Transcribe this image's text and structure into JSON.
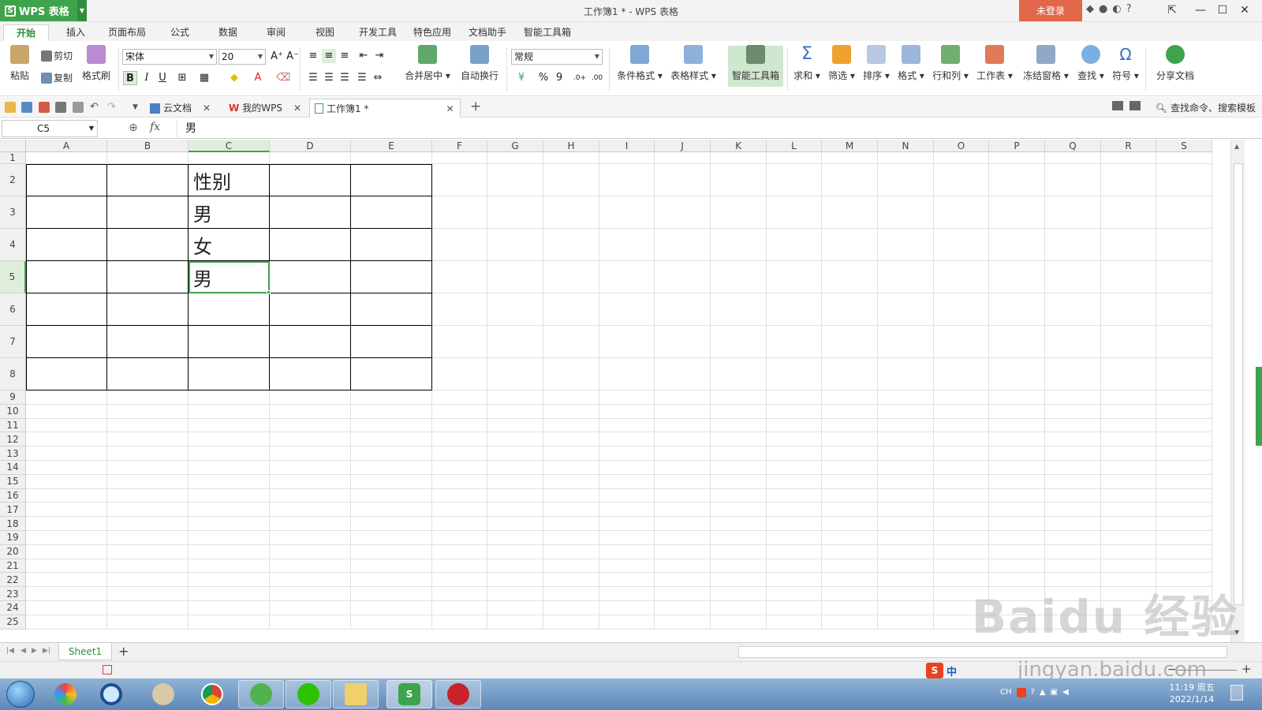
{
  "titlebar": {
    "app_name": "WPS 表格",
    "window_title": "工作簿1 * - WPS 表格",
    "login_label": "未登录",
    "help_label": "?"
  },
  "menu": {
    "tabs": [
      {
        "label": "开始"
      },
      {
        "label": "插入"
      },
      {
        "label": "页面布局"
      },
      {
        "label": "公式"
      },
      {
        "label": "数据"
      },
      {
        "label": "审阅"
      },
      {
        "label": "视图"
      },
      {
        "label": "开发工具"
      },
      {
        "label": "特色应用"
      },
      {
        "label": "文档助手"
      },
      {
        "label": "智能工具箱"
      }
    ]
  },
  "ribbon": {
    "paste": "粘贴",
    "cut": "剪切",
    "copy": "复制",
    "format_painter": "格式刷",
    "font_name": "宋体",
    "font_size": "20",
    "bold": "B",
    "italic": "I",
    "underline": "U",
    "merge_center": "合并居中",
    "wrap_text": "自动换行",
    "number_format": "常规",
    "percent": "%",
    "comma": "9",
    "conditional_format": "条件格式",
    "table_style": "表格样式",
    "smart_toolbox": "智能工具箱",
    "sum": "求和",
    "filter": "筛选",
    "sort": "排序",
    "format": "格式",
    "row_col": "行和列",
    "worksheet": "工作表",
    "freeze": "冻结窗格",
    "find": "查找",
    "symbol": "符号",
    "share": "分享文档"
  },
  "doc_tabs": [
    {
      "label": "云文档"
    },
    {
      "label": "我的WPS"
    },
    {
      "label": "工作簿1 *"
    }
  ],
  "search_command": "查找命令、搜索模板",
  "formula": {
    "name_box": "C5",
    "fx": "fx",
    "value": "男"
  },
  "sheet": {
    "columns": [
      "A",
      "B",
      "C",
      "D",
      "E",
      "F",
      "G",
      "H",
      "I",
      "J",
      "K",
      "L",
      "M",
      "N",
      "O",
      "P",
      "Q",
      "R",
      "S"
    ],
    "rows": [
      "1",
      "2",
      "3",
      "4",
      "5",
      "6",
      "7",
      "8",
      "9",
      "10",
      "11",
      "12",
      "13",
      "14",
      "15",
      "16",
      "17",
      "18",
      "19",
      "20",
      "21",
      "22",
      "23",
      "24",
      "25"
    ],
    "cells": {
      "C2": "性别",
      "C3": "男",
      "C4": "女",
      "C5": "男"
    },
    "selected_cell": "C5",
    "tabs": [
      {
        "label": "Sheet1"
      }
    ]
  },
  "statusbar": {
    "ime": "中"
  },
  "taskbar": {
    "clock_time": "11:19 周五",
    "clock_date": "2022/1/14",
    "tray_lang": "CH"
  },
  "watermark": {
    "main": "Baidu 经验",
    "url": "jingyan.baidu.com"
  },
  "colors": {
    "brand_green": "#3fa34d",
    "login_red": "#e2674a"
  }
}
